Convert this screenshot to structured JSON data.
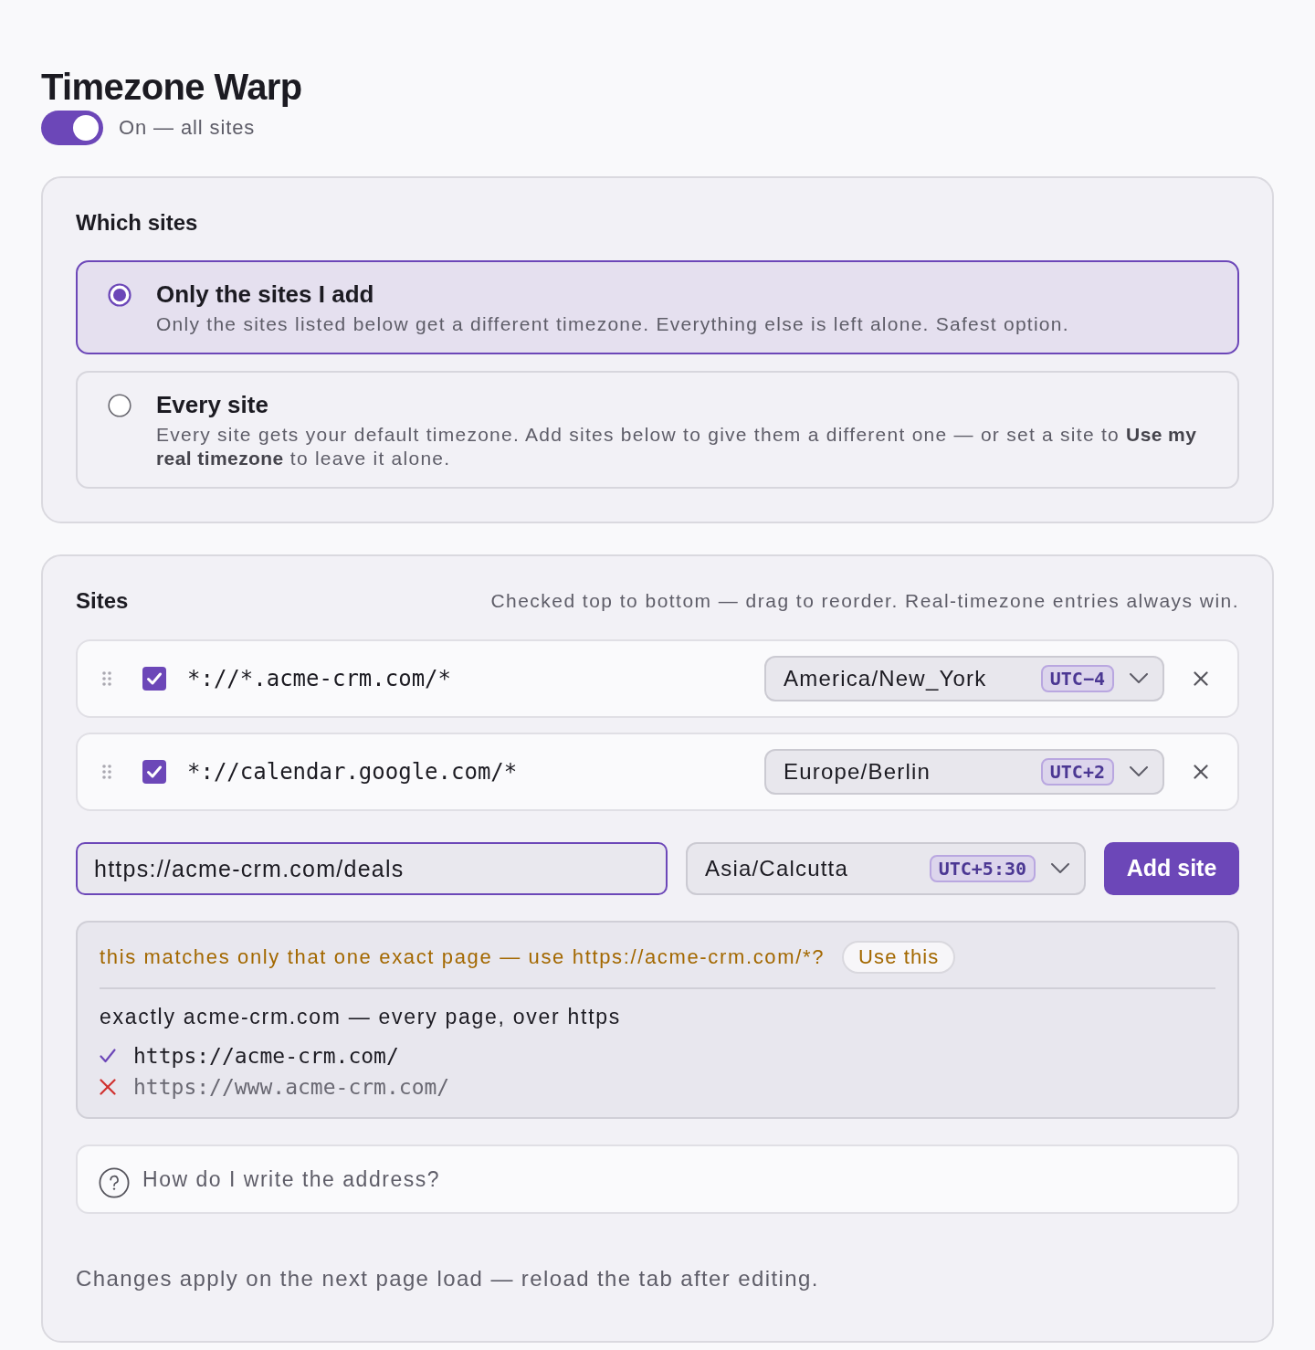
{
  "header": {
    "title": "Timezone Warp",
    "toggle": {
      "on": true,
      "label": "On — all sites"
    }
  },
  "scope": {
    "heading": "Which sites",
    "options": [
      {
        "title": "Only the sites I add",
        "description": "Only the sites listed below get a different timezone. Everything else is left alone. Safest option.",
        "selected": true
      },
      {
        "title": "Every site",
        "description": "Every site gets your default timezone. Add sites below to give them a different one — or set a site to **Use my real timezone** to leave it alone.",
        "selected": false
      }
    ]
  },
  "sites": {
    "heading": "Sites",
    "hint": "Checked top to bottom — drag to reorder. Real-timezone entries always win.",
    "rows": [
      {
        "enabled": true,
        "pattern": "*://*.acme-crm.com/*",
        "timezone": "America/New_York",
        "offset": "UTC−4"
      },
      {
        "enabled": true,
        "pattern": "*://calendar.google.com/*",
        "timezone": "Europe/Berlin",
        "offset": "UTC+2"
      }
    ],
    "new_site": {
      "value": "https://acme-crm.com/deals",
      "timezone": "Asia/Calcutta",
      "offset": "UTC+5:30",
      "button": "Add site"
    },
    "preview": {
      "warning": "this matches only that one exact page — use https://acme-crm.com/*?",
      "suggestion_button": "Use this",
      "summary": "exactly acme-crm.com — every page, over https",
      "examples": [
        {
          "url": "https://acme-crm.com/",
          "matches": true
        },
        {
          "url": "https://www.acme-crm.com/",
          "matches": false
        }
      ]
    },
    "help": {
      "label": "How do I write the address?"
    },
    "footer": "Changes apply on the next page load — reload the tab after editing."
  }
}
